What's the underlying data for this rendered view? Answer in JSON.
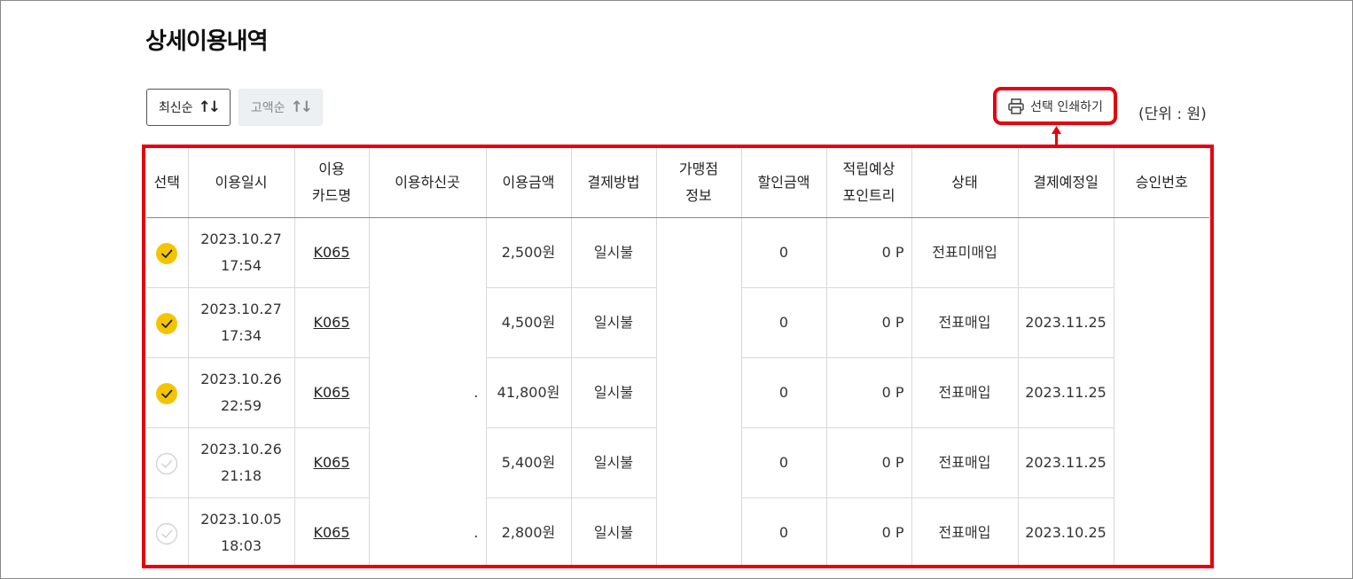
{
  "page": {
    "title": "상세이용내역"
  },
  "sort": {
    "latest_label": "최신순",
    "amount_label": "고액순",
    "icon": "sort-arrows-icon"
  },
  "toolbar": {
    "print_label": "선택 인쇄하기",
    "print_icon": "printer-icon",
    "unit_label": "(단위 : 원)"
  },
  "colors": {
    "highlight": "#e8000d",
    "checked": "#f5c400",
    "unchecked": "#d4d4d4"
  },
  "table": {
    "headers": [
      {
        "line1": "선택",
        "line2": ""
      },
      {
        "line1": "이용일시",
        "line2": ""
      },
      {
        "line1": "이용",
        "line2": "카드명"
      },
      {
        "line1": "이용하신곳",
        "line2": ""
      },
      {
        "line1": "이용금액",
        "line2": ""
      },
      {
        "line1": "결제방법",
        "line2": ""
      },
      {
        "line1": "가맹점",
        "line2": "정보"
      },
      {
        "line1": "할인금액",
        "line2": ""
      },
      {
        "line1": "적립예상",
        "line2": "포인트리"
      },
      {
        "line1": "상태",
        "line2": ""
      },
      {
        "line1": "결제예정일",
        "line2": ""
      },
      {
        "line1": "승인번호",
        "line2": ""
      }
    ],
    "rows": [
      {
        "checked": true,
        "date": "2023.10.27",
        "time": "17:54",
        "card": "K065",
        "place": "",
        "amount": "2,500원",
        "payment": "일시불",
        "merchant": "",
        "discount": "0",
        "points": "0 P",
        "status": "전표미매입",
        "due": "",
        "approval": ""
      },
      {
        "checked": true,
        "date": "2023.10.27",
        "time": "17:34",
        "card": "K065",
        "place": "",
        "amount": "4,500원",
        "payment": "일시불",
        "merchant": "",
        "discount": "0",
        "points": "0 P",
        "status": "전표매입",
        "due": "2023.11.25",
        "approval": ""
      },
      {
        "checked": true,
        "date": "2023.10.26",
        "time": "22:59",
        "card": "K065",
        "place": ".",
        "amount": "41,800원",
        "payment": "일시불",
        "merchant": "",
        "discount": "0",
        "points": "0 P",
        "status": "전표매입",
        "due": "2023.11.25",
        "approval": ""
      },
      {
        "checked": false,
        "date": "2023.10.26",
        "time": "21:18",
        "card": "K065",
        "place": "",
        "amount": "5,400원",
        "payment": "일시불",
        "merchant": "",
        "discount": "0",
        "points": "0 P",
        "status": "전표매입",
        "due": "2023.11.25",
        "approval": ""
      },
      {
        "checked": false,
        "date": "2023.10.05",
        "time": "18:03",
        "card": "K065",
        "place": ".",
        "amount": "2,800원",
        "payment": "일시불",
        "merchant": "",
        "discount": "0",
        "points": "0 P",
        "status": "전표매입",
        "due": "2023.10.25",
        "approval": ""
      }
    ]
  }
}
